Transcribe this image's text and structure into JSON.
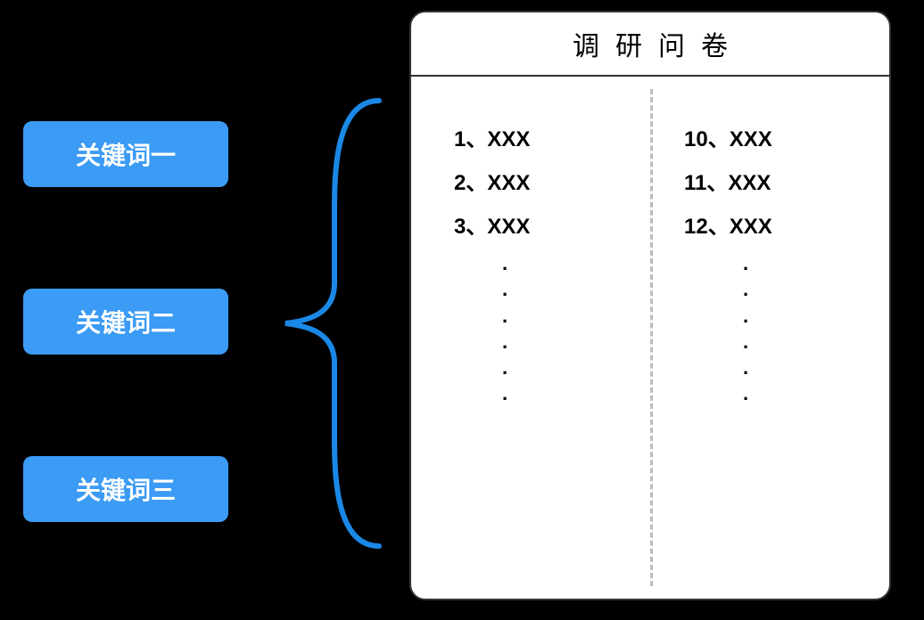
{
  "keywords": {
    "items": [
      {
        "label": "关键词一"
      },
      {
        "label": "关键词二"
      },
      {
        "label": "关键词三"
      }
    ]
  },
  "questionnaire": {
    "title": "调研问卷",
    "columns": [
      {
        "items": [
          {
            "label": "1、XXX"
          },
          {
            "label": "2、XXX"
          },
          {
            "label": "3、XXX"
          }
        ]
      },
      {
        "items": [
          {
            "label": "10、XXX"
          },
          {
            "label": "11、XXX"
          },
          {
            "label": "12、XXX"
          }
        ]
      }
    ],
    "dot": "."
  },
  "colors": {
    "keyword_bg": "#3b9bf5",
    "brace": "#1a88e6",
    "card_bg": "#ffffff",
    "bg": "#000000"
  }
}
